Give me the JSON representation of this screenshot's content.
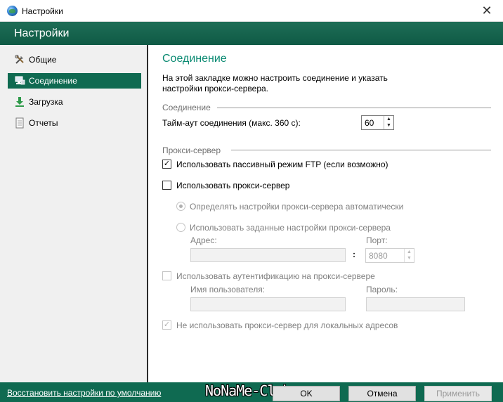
{
  "window": {
    "title": "Настройки",
    "close_glyph": "✕",
    "app_icon": "globe-icon"
  },
  "header": {
    "title": "Настройки"
  },
  "sidebar": {
    "items": [
      {
        "label": "Общие",
        "icon": "tools-icon",
        "active": false
      },
      {
        "label": "Соединение",
        "icon": "network-icon",
        "active": true
      },
      {
        "label": "Загрузка",
        "icon": "download-icon",
        "active": false
      },
      {
        "label": "Отчеты",
        "icon": "report-icon",
        "active": false
      }
    ]
  },
  "main": {
    "title": "Соединение",
    "intro": "На этой закладке можно настроить соединение и указать настройки прокси-сервера.",
    "connection_group": {
      "title": "Соединение",
      "timeout_label": "Тайм-аут соединения (макс. 360 с):",
      "timeout_value": "60"
    },
    "proxy_group": {
      "title": "Прокси-сервер",
      "passive_ftp": {
        "label": "Использовать пассивный режим FTP (если возможно)",
        "checked": true
      },
      "use_proxy": {
        "label": "Использовать прокси-сервер",
        "checked": false
      },
      "auto_detect": {
        "label": "Определять настройки прокси-сервера автоматически",
        "selected": true,
        "enabled": false
      },
      "manual": {
        "label": "Использовать заданные настройки прокси-сервера",
        "selected": false,
        "enabled": false
      },
      "address_label": "Адрес:",
      "address_value": "",
      "colon": ":",
      "port_label": "Порт:",
      "port_value": "8080",
      "auth": {
        "label": "Использовать аутентификацию на прокси-сервере",
        "checked": false,
        "enabled": false
      },
      "username_label": "Имя пользователя:",
      "username_value": "",
      "password_label": "Пароль:",
      "password_value": "",
      "bypass_local": {
        "label": "Не использовать прокси-сервер для локальных адресов",
        "checked": true,
        "enabled": false
      }
    }
  },
  "footer": {
    "reset_link": "Восстановить настройки по умолчанию",
    "watermark": "NoNaMe-Club",
    "ok_label": "OK",
    "cancel_label": "Отмена",
    "apply_label": "Применить"
  },
  "colors": {
    "accent": "#0f6a51",
    "title_green": "#0a8a72"
  }
}
